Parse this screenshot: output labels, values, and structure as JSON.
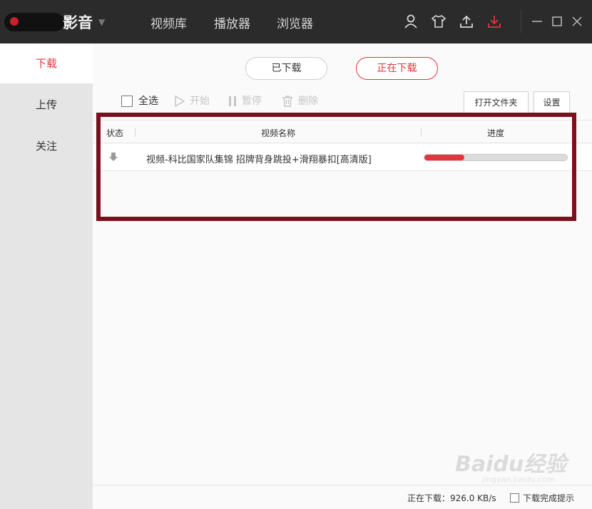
{
  "app": {
    "title": "影音",
    "nav": [
      "视频库",
      "播放器",
      "浏览器"
    ]
  },
  "colors": {
    "accent": "#e3353b",
    "titlebar": "#2b2b2b",
    "sidebar": "#e5e5e5",
    "highlight": "#7d0e1c"
  },
  "icons": [
    "user-icon",
    "skin-icon",
    "upload-icon",
    "download-icon",
    "minimize-icon",
    "maximize-icon",
    "close-icon"
  ],
  "sidebar": {
    "items": [
      "下载",
      "上传",
      "关注"
    ]
  },
  "tabs": {
    "downloaded": "已下载",
    "downloading": "正在下载"
  },
  "toolbar": {
    "select_all": "全选",
    "start": "开始",
    "pause": "暂停",
    "delete": "删除",
    "open_folder": "打开文件夹",
    "settings": "设置"
  },
  "table": {
    "headers": {
      "status": "状态",
      "name": "视频名称",
      "progress": "进度"
    },
    "rows": [
      {
        "name": "视频-科比国家队集锦 招牌背身跳投+滑翔暴扣[高清版]",
        "progress": 0.28
      }
    ]
  },
  "status": {
    "speed": "正在下载：926.0 KB/s",
    "notify_label": "下载完成提示"
  },
  "watermark": {
    "brand": "Baidu经验",
    "url": "jingyan.baidu.com"
  }
}
